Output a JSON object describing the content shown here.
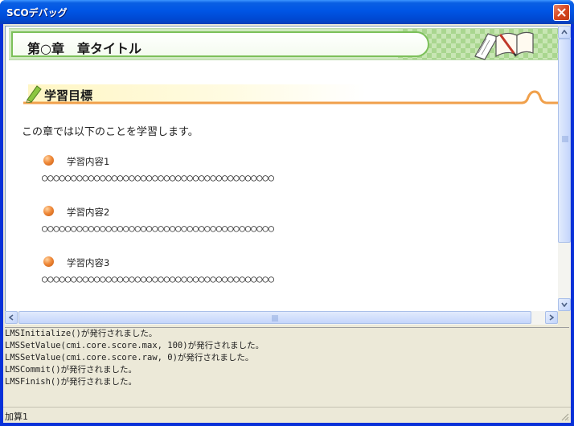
{
  "window": {
    "title": "SCOデバッグ"
  },
  "chapter": {
    "title": "第○章　章タイトル"
  },
  "goals": {
    "heading": "学習目標",
    "intro": "この章では以下のことを学習します。",
    "items": [
      {
        "title": "学習内容1",
        "body": "○○○○○○○○○○○○○○○○○○○○○○○○○○○○○○○○○○○○○○○○"
      },
      {
        "title": "学習内容2",
        "body": "○○○○○○○○○○○○○○○○○○○○○○○○○○○○○○○○○○○○○○○○"
      },
      {
        "title": "学習内容3",
        "body": "○○○○○○○○○○○○○○○○○○○○○○○○○○○○○○○○○○○○○○○○"
      }
    ]
  },
  "log": {
    "lines": [
      "LMSInitialize()が発行されました。",
      "LMSSetValue(cmi.core.score.max, 100)が発行されました。",
      "LMSSetValue(cmi.core.score.raw, 0)が発行されました。",
      "LMSCommit()が発行されました。",
      "LMSFinish()が発行されました。"
    ]
  },
  "status": {
    "text": "加算1"
  },
  "colors": {
    "titlebar": "#0055e5",
    "banner_green": "#7cc05a",
    "goal_orange": "#f0a04b",
    "log_bg": "#ece9d8"
  }
}
